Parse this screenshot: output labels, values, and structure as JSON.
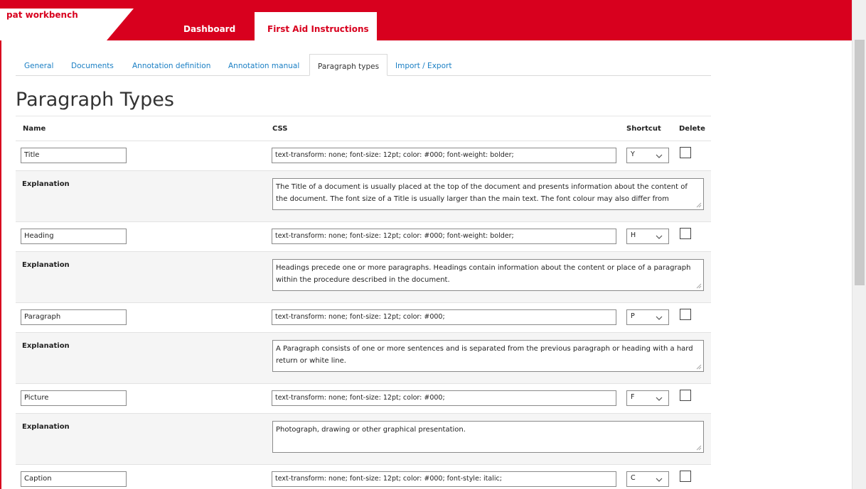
{
  "app": {
    "brand": "pat workbench"
  },
  "nav": {
    "dashboard": "Dashboard",
    "active_tab": "First Aid Instructions"
  },
  "subtabs": [
    {
      "label": "General"
    },
    {
      "label": "Documents"
    },
    {
      "label": "Annotation definition"
    },
    {
      "label": "Annotation manual"
    },
    {
      "label": "Paragraph types",
      "active": true
    },
    {
      "label": "Import / Export"
    }
  ],
  "page": {
    "title": "Paragraph Types"
  },
  "table": {
    "headers": {
      "name": "Name",
      "css": "CSS",
      "shortcut": "Shortcut",
      "delete": "Delete"
    },
    "explanation_label": "Explanation",
    "rows": [
      {
        "name": "Title",
        "css": "text-transform: none; font-size: 12pt; color: #000; font-weight: bolder;",
        "shortcut": "Y",
        "explanation": "The Title of a document is usually placed at the top of the document and presents information about the content of the document. The font size of a Title is usually larger than the main text. The font colour may also differ from"
      },
      {
        "name": "Heading",
        "css": "text-transform: none; font-size: 12pt; color: #000; font-weight: bolder;",
        "shortcut": "H",
        "explanation": "Headings precede one or more paragraphs. Headings contain information about the content or place of a paragraph within the procedure described in the document."
      },
      {
        "name": "Paragraph",
        "css": "text-transform: none; font-size: 12pt; color: #000;",
        "shortcut": "P",
        "explanation": "A Paragraph consists of one or more sentences and is separated from the previous paragraph or heading with a hard return or white line."
      },
      {
        "name": "Picture",
        "css": "text-transform: none; font-size: 12pt; color: #000;",
        "shortcut": "F",
        "explanation": "Photograph, drawing or other graphical presentation."
      },
      {
        "name": "Caption",
        "css": "text-transform: none; font-size: 12pt; color: #000; font-style: italic;",
        "shortcut": "C"
      }
    ]
  },
  "colors": {
    "brand_red": "#d8001e",
    "link_blue": "#1a7fc4"
  }
}
